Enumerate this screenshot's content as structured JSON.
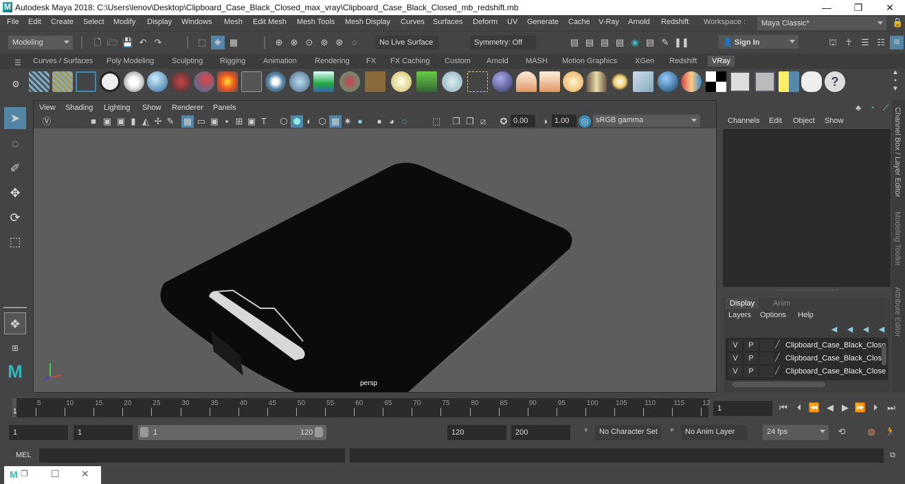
{
  "window": {
    "title": "Autodesk Maya 2018: C:\\Users\\lenov\\Desktop\\Clipboard_Case_Black_Closed_max_vray\\Clipboard_Case_Black_Closed_mb_redshift.mb",
    "logo": "M",
    "minimize": "—",
    "restore": "❐",
    "close": "✕"
  },
  "menubar": {
    "items": [
      "File",
      "Edit",
      "Create",
      "Select",
      "Modify",
      "Display",
      "Windows",
      "Mesh",
      "Edit Mesh",
      "Mesh Tools",
      "Mesh Display",
      "Curves",
      "Surfaces",
      "Deform",
      "UV",
      "Generate",
      "Cache",
      "V-Ray",
      "Arnold",
      "Redshift"
    ],
    "workspace_label": "Workspace :",
    "workspace_value": "Maya Classic*"
  },
  "toolbar": {
    "mode": "Modeling",
    "live_surface": "No Live Surface",
    "symmetry": "Symmetry: Off",
    "sign_in": "Sign In"
  },
  "shelf": {
    "tabs": [
      "Curves / Surfaces",
      "Poly Modeling",
      "Sculpting",
      "Rigging",
      "Animation",
      "Rendering",
      "FX",
      "FX Caching",
      "Custom",
      "Arnold",
      "MASH",
      "Motion Graphics",
      "XGen",
      "Redshift",
      "VRay"
    ],
    "active_tab": "VRay"
  },
  "viewport": {
    "menus": [
      "View",
      "Shading",
      "Lighting",
      "Show",
      "Renderer",
      "Panels"
    ],
    "exposure": "0.00",
    "gamma": "1.00",
    "color_space": "sRGB gamma",
    "camera_label": "persp"
  },
  "channel_box": {
    "menus": [
      "Channels",
      "Edit",
      "Object",
      "Show"
    ],
    "vertical_tabs": [
      "Channel Box / Layer Editor",
      "Modeling Toolkit",
      "Attribute Editor"
    ]
  },
  "layer_editor": {
    "tabs": [
      "Display",
      "Anim"
    ],
    "active_tab": "Display",
    "menus": [
      "Layers",
      "Options",
      "Help"
    ],
    "layers": [
      {
        "v": "V",
        "p": "P",
        "name": "Clipboard_Case_Black_Close"
      },
      {
        "v": "V",
        "p": "P",
        "name": "Clipboard_Case_Black_Close"
      },
      {
        "v": "V",
        "p": "P",
        "name": "Clipboard_Case_Black_Close"
      }
    ]
  },
  "timeline": {
    "ticks": [
      "5",
      "10",
      "15",
      "20",
      "25",
      "30",
      "35",
      "40",
      "45",
      "50",
      "55",
      "60",
      "65",
      "70",
      "75",
      "80",
      "85",
      "90",
      "95",
      "100",
      "105",
      "110",
      "115",
      "12"
    ],
    "current_frame_marker": "1",
    "current_frame": "1"
  },
  "range": {
    "start": "1",
    "playback_start": "1",
    "slider_start": "1",
    "slider_end": "120",
    "playback_end": "120",
    "end": "200",
    "character_set": "No Character Set",
    "anim_layer": "No Anim Layer",
    "fps": "24 fps"
  },
  "command_line": {
    "label": "MEL"
  }
}
